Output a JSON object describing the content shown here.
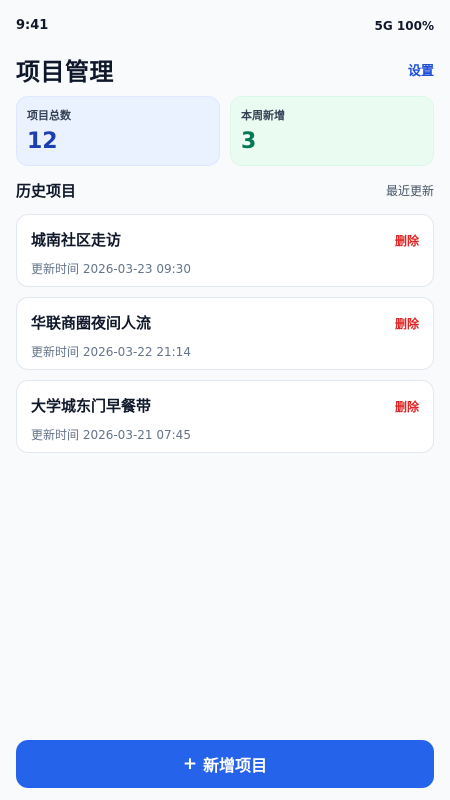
{
  "status_bar": {
    "time": "9:41",
    "network": "5G 100%"
  },
  "header": {
    "title": "项目管理",
    "settings_label": "设置"
  },
  "stats": [
    {
      "label": "项目总数",
      "value": "12"
    },
    {
      "label": "本周新增",
      "value": "3"
    }
  ],
  "section": {
    "title": "历史项目",
    "sort_label": "最近更新"
  },
  "projects": [
    {
      "name": "城南社区走访",
      "updated": "更新时间 2026-03-23 09:30",
      "delete_label": "删除"
    },
    {
      "name": "华联商圈夜间人流",
      "updated": "更新时间 2026-03-22 21:14",
      "delete_label": "删除"
    },
    {
      "name": "大学城东门早餐带",
      "updated": "更新时间 2026-03-21 07:45",
      "delete_label": "删除"
    }
  ],
  "footer": {
    "add_icon": "plus-icon",
    "add_label": "新增项目",
    "plus_glyph": "+"
  },
  "colors": {
    "accent": "#2563eb",
    "danger": "#dc2626",
    "stat_blue": "#1e40af",
    "stat_green": "#047857"
  }
}
